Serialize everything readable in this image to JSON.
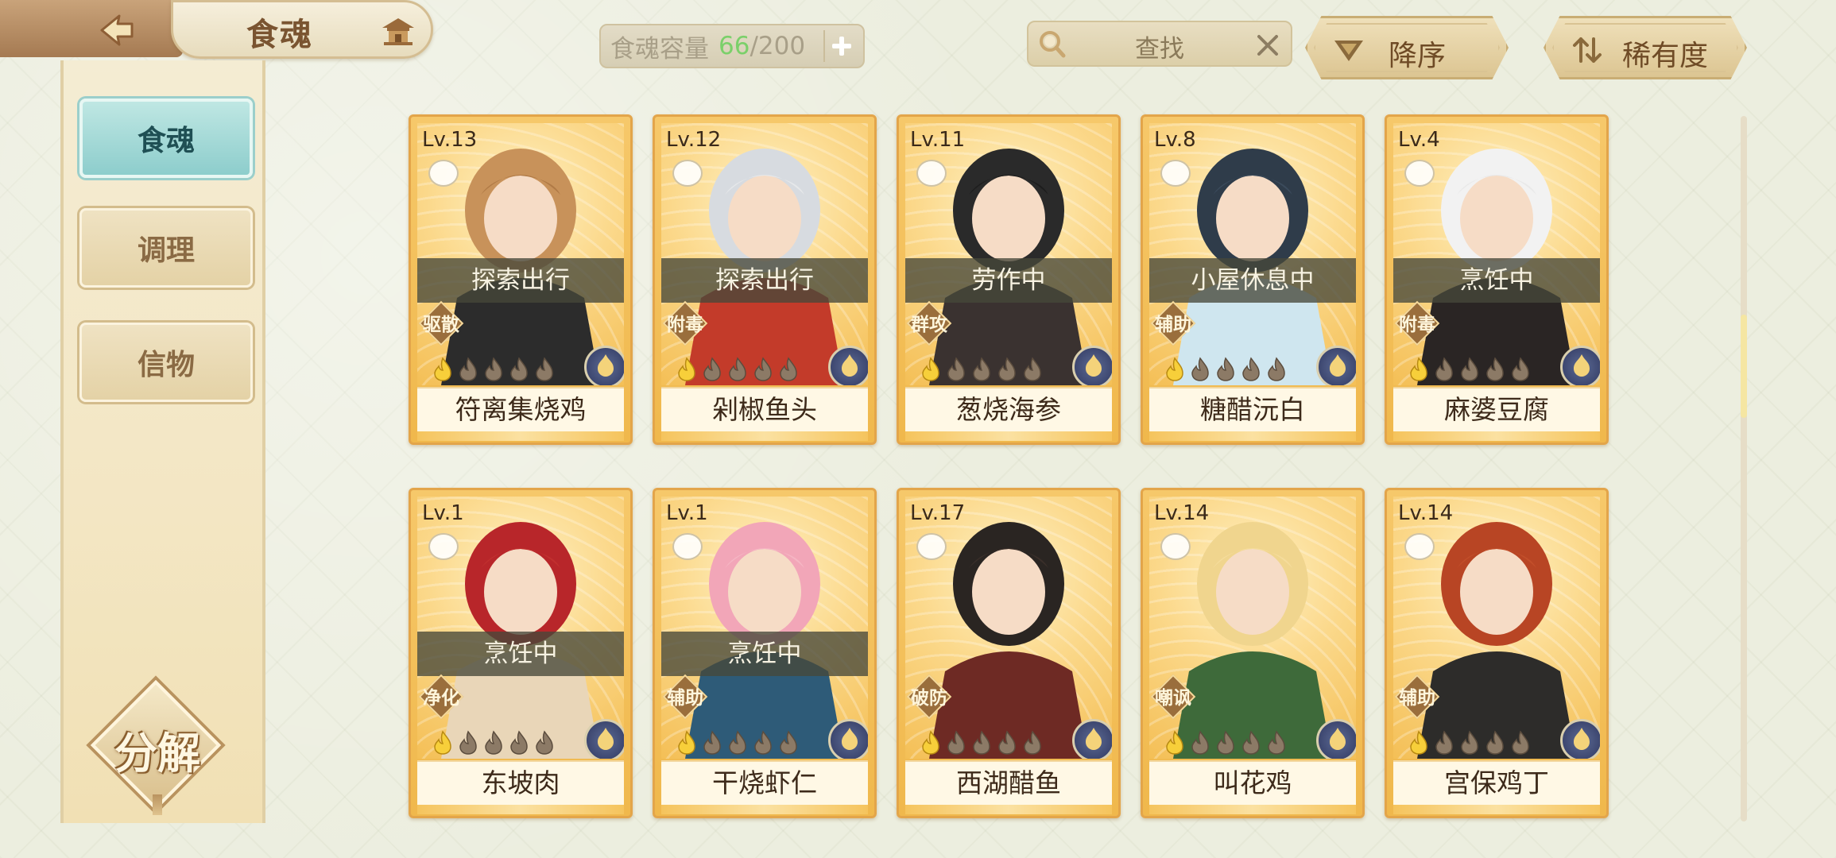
{
  "header": {
    "title": "食魂",
    "back_icon": "back-arrow-icon",
    "home_icon": "restaurant-pavilion-icon"
  },
  "capacity": {
    "label": "食魂容量",
    "current": "66",
    "separator": "/",
    "max": "200",
    "add_icon": "plus-icon"
  },
  "search": {
    "placeholder": "查找",
    "icon": "search-icon",
    "clear_icon": "close-icon"
  },
  "sort": {
    "order_label": "降序",
    "rarity_label": "稀有度"
  },
  "sidebar": {
    "tabs": [
      {
        "label": "食魂",
        "active": true
      },
      {
        "label": "调理",
        "active": false
      },
      {
        "label": "信物",
        "active": false
      }
    ],
    "decompose_label": "分解"
  },
  "colors": {
    "accent_teal": "#8dcdcc",
    "card_gold": "#f0b84c",
    "capacity_green": "#7bd06a",
    "brown_text": "#6f4b26"
  },
  "cards": [
    {
      "level": "Lv.13",
      "status": "探索出行",
      "role": "驱散",
      "name": "符离集烧鸡"
    },
    {
      "level": "Lv.12",
      "status": "探索出行",
      "role": "附毒",
      "name": "剁椒鱼头"
    },
    {
      "level": "Lv.11",
      "status": "劳作中",
      "role": "群攻",
      "name": "葱烧海参"
    },
    {
      "level": "Lv.8",
      "status": "小屋休息中",
      "role": "辅助",
      "name": "糖醋沅白"
    },
    {
      "level": "Lv.4",
      "status": "烹饪中",
      "role": "附毒",
      "name": "麻婆豆腐"
    },
    {
      "level": "Lv.1",
      "status": "烹饪中",
      "role": "净化",
      "name": "东坡肉"
    },
    {
      "level": "Lv.1",
      "status": "烹饪中",
      "role": "辅助",
      "name": "干烧虾仁"
    },
    {
      "level": "Lv.17",
      "status": "",
      "role": "破防",
      "name": "西湖醋鱼"
    },
    {
      "level": "Lv.14",
      "status": "",
      "role": "嘲讽",
      "name": "叫花鸡"
    },
    {
      "level": "Lv.14",
      "status": "",
      "role": "辅助",
      "name": "宫保鸡丁"
    }
  ]
}
